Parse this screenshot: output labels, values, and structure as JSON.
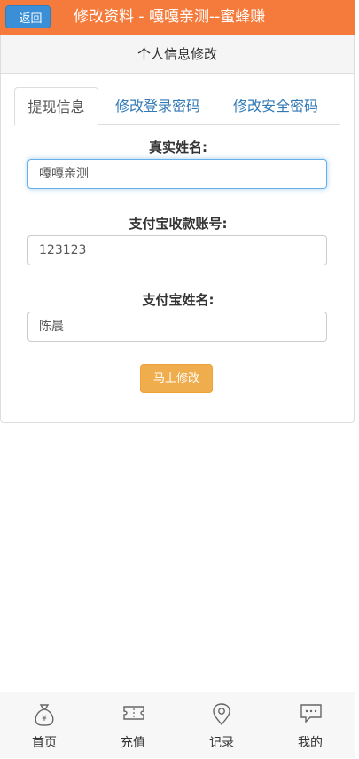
{
  "header": {
    "back_label": "返回",
    "title": "修改资料 - 嘎嘎亲测--蜜蜂赚"
  },
  "panel": {
    "heading": "个人信息修改"
  },
  "tabs": [
    {
      "label": "提现信息",
      "active": true
    },
    {
      "label": "修改登录密码",
      "active": false
    },
    {
      "label": "修改安全密码",
      "active": false
    }
  ],
  "form": {
    "real_name_label": "真实姓名:",
    "real_name_value": "嘎嘎亲测",
    "alipay_account_label": "支付宝收款账号:",
    "alipay_account_value": "123123",
    "alipay_name_label": "支付宝姓名:",
    "alipay_name_value": "陈晨",
    "submit_label": "马上修改"
  },
  "bottom_nav": [
    {
      "label": "首页",
      "icon": "money-bag-icon"
    },
    {
      "label": "充值",
      "icon": "ticket-icon"
    },
    {
      "label": "记录",
      "icon": "location-pin-icon"
    },
    {
      "label": "我的",
      "icon": "chat-bubble-icon"
    }
  ],
  "colors": {
    "header_bg": "#f47b3b",
    "back_button": "#3a8fd6",
    "submit_button": "#f0ad4e",
    "tab_link": "#337ab7"
  }
}
